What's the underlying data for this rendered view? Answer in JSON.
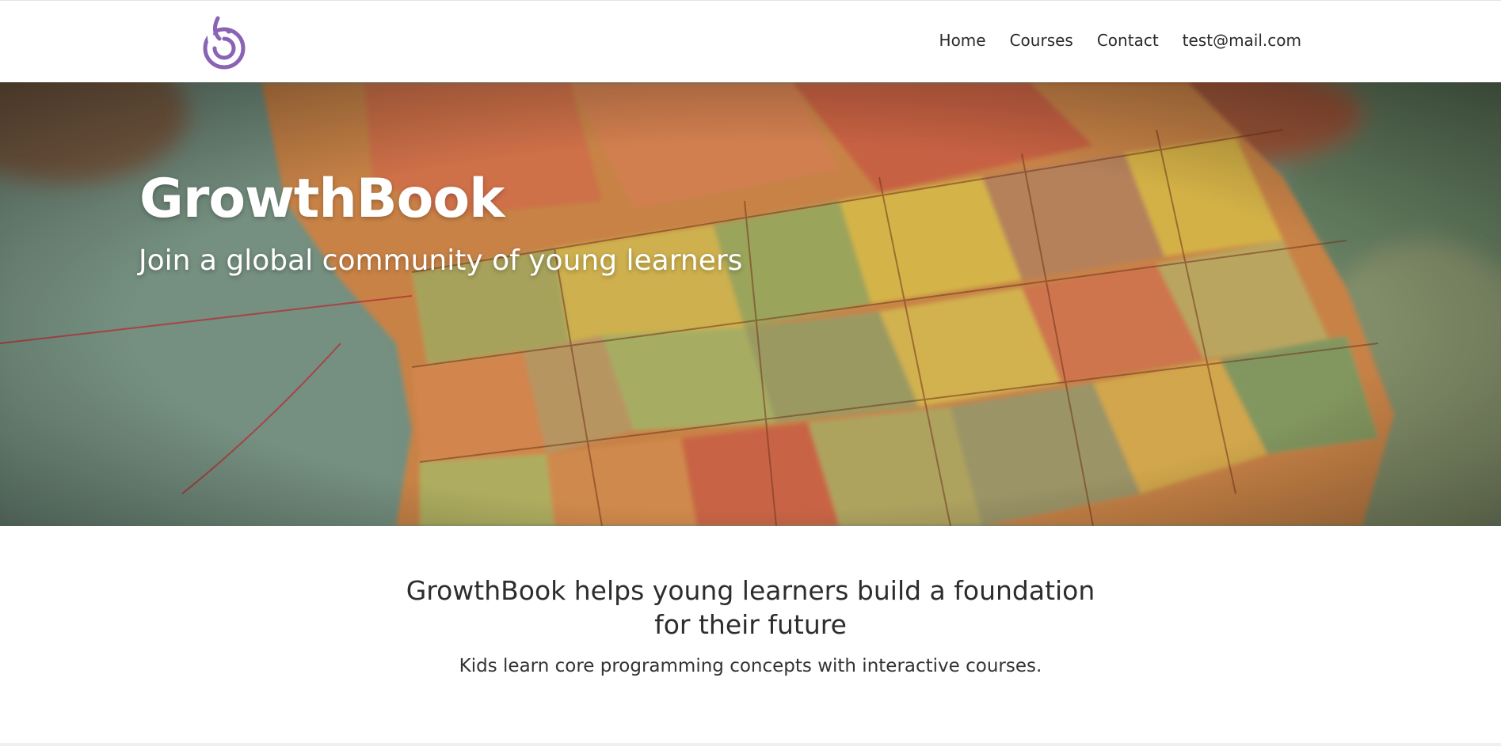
{
  "header": {
    "logo_icon": "growthbook-logo-icon",
    "brand_color": "#8a63b5",
    "nav": [
      {
        "label": "Home"
      },
      {
        "label": "Courses"
      },
      {
        "label": "Contact"
      },
      {
        "label": "test@mail.com"
      }
    ]
  },
  "hero": {
    "title": "GrowthBook",
    "subtitle": "Join a global community of young learners",
    "background": "vintage-globe-map-photo"
  },
  "intro": {
    "heading": "GrowthBook helps young learners build a foundation for their future",
    "text": "Kids learn core programming concepts with interactive courses."
  }
}
